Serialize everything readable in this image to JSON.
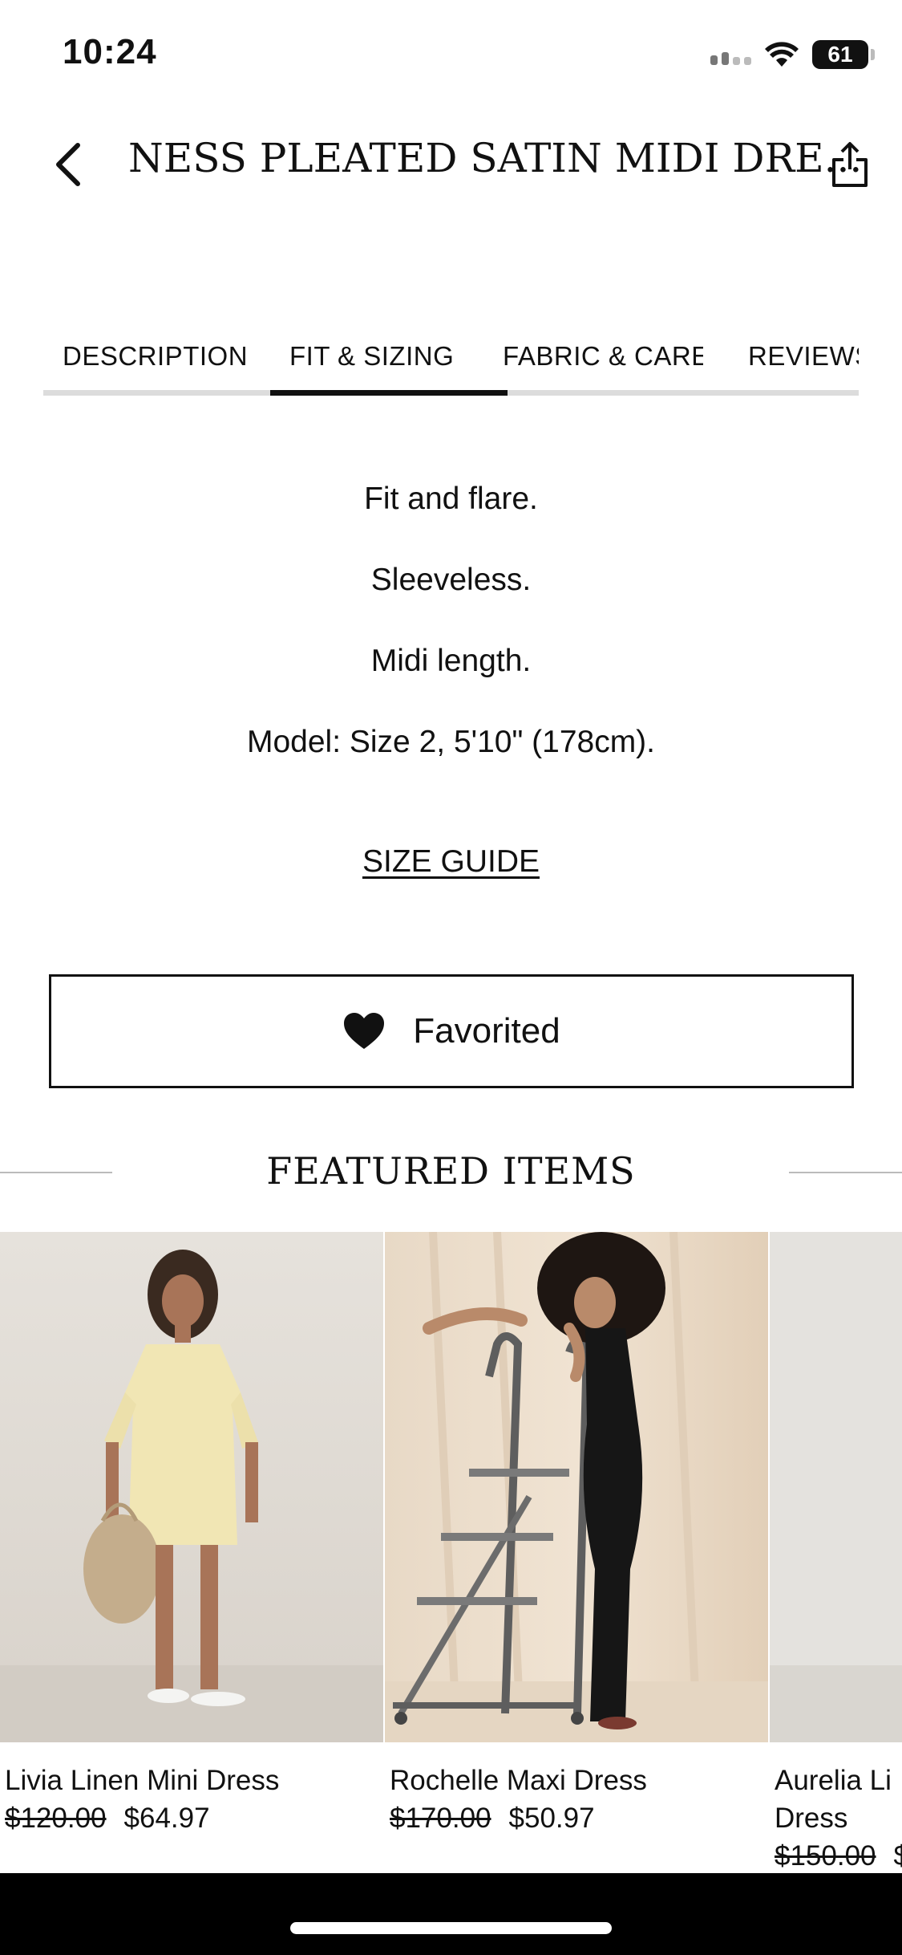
{
  "status_bar": {
    "time": "10:24",
    "battery": "61"
  },
  "header": {
    "title": "NESS PLEATED SATIN MIDI DRE..."
  },
  "tabs": [
    {
      "label": "DESCRIPTION"
    },
    {
      "label": "FIT & SIZING",
      "active": true
    },
    {
      "label": "FABRIC & CARE"
    },
    {
      "label": "REVIEWS"
    }
  ],
  "fit_details": [
    "Fit and flare.",
    "Sleeveless.",
    "Midi length.",
    "Model: Size 2, 5'10\" (178cm)."
  ],
  "size_guide_label": "SIZE GUIDE",
  "favorite_button": {
    "label": "Favorited",
    "icon": "heart-filled-icon"
  },
  "featured": {
    "title": "FEATURED ITEMS",
    "items": [
      {
        "name": "Livia Linen Mini Dress",
        "price_old": "$120.00",
        "price_new": "$64.97"
      },
      {
        "name": "Rochelle Maxi Dress",
        "price_old": "$170.00",
        "price_new": "$50.97"
      },
      {
        "name": "Aurelia Li... Dress",
        "name_line1": "Aurelia Li",
        "name_line2": "Dress",
        "price_old": "$150.00",
        "price_new": "$"
      }
    ]
  },
  "colors": {
    "accent": "#111111",
    "tab_track": "#dcdcdc",
    "background": "#ffffff"
  }
}
